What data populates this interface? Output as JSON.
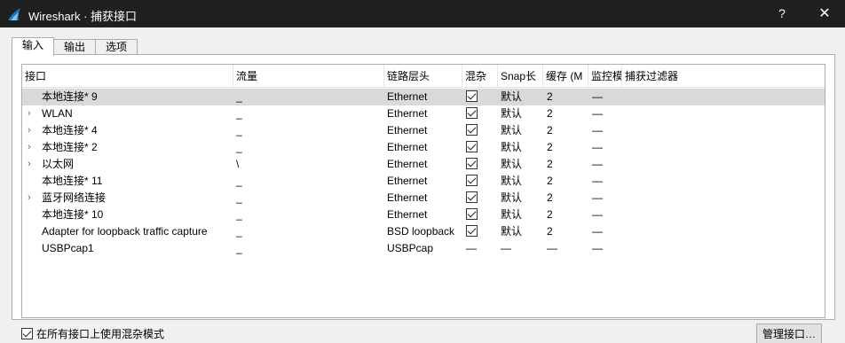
{
  "window": {
    "title": "Wireshark · 捕获接口",
    "help_glyph": "?",
    "close_glyph": "✕"
  },
  "tabs": [
    {
      "label": "输入",
      "active": true
    },
    {
      "label": "输出",
      "active": false
    },
    {
      "label": "选项",
      "active": false
    }
  ],
  "table": {
    "headers": [
      "接口",
      "流量",
      "链路层头",
      "混杂",
      "Snap长",
      "缓存 (M",
      "监控模",
      "捕获过滤器"
    ],
    "rows": [
      {
        "expandable": false,
        "interface": "本地连接* 9",
        "traffic": "_",
        "link": "Ethernet",
        "promisc": true,
        "snap": "默认",
        "buffer": "2",
        "monitor": "—",
        "filter": "",
        "selected": true
      },
      {
        "expandable": true,
        "interface": "WLAN",
        "traffic": "_",
        "link": "Ethernet",
        "promisc": true,
        "snap": "默认",
        "buffer": "2",
        "monitor": "—",
        "filter": "",
        "selected": false
      },
      {
        "expandable": true,
        "interface": "本地连接* 4",
        "traffic": "_",
        "link": "Ethernet",
        "promisc": true,
        "snap": "默认",
        "buffer": "2",
        "monitor": "—",
        "filter": "",
        "selected": false
      },
      {
        "expandable": true,
        "interface": "本地连接* 2",
        "traffic": "_",
        "link": "Ethernet",
        "promisc": true,
        "snap": "默认",
        "buffer": "2",
        "monitor": "—",
        "filter": "",
        "selected": false
      },
      {
        "expandable": true,
        "interface": "以太网",
        "traffic": "\\",
        "link": "Ethernet",
        "promisc": true,
        "snap": "默认",
        "buffer": "2",
        "monitor": "—",
        "filter": "",
        "selected": false
      },
      {
        "expandable": false,
        "interface": "本地连接* 11",
        "traffic": "_",
        "link": "Ethernet",
        "promisc": true,
        "snap": "默认",
        "buffer": "2",
        "monitor": "—",
        "filter": "",
        "selected": false
      },
      {
        "expandable": true,
        "interface": "蓝牙网络连接",
        "traffic": "_",
        "link": "Ethernet",
        "promisc": true,
        "snap": "默认",
        "buffer": "2",
        "monitor": "—",
        "filter": "",
        "selected": false
      },
      {
        "expandable": false,
        "interface": "本地连接* 10",
        "traffic": "_",
        "link": "Ethernet",
        "promisc": true,
        "snap": "默认",
        "buffer": "2",
        "monitor": "—",
        "filter": "",
        "selected": false
      },
      {
        "expandable": false,
        "interface": "Adapter for loopback traffic capture",
        "traffic": "_",
        "link": "BSD loopback",
        "promisc": true,
        "snap": "默认",
        "buffer": "2",
        "monitor": "—",
        "filter": "",
        "selected": false
      },
      {
        "expandable": false,
        "interface": "USBPcap1",
        "traffic": "_",
        "link": "USBPcap",
        "promisc": null,
        "snap": "—",
        "buffer": "—",
        "monitor": "—",
        "filter": "",
        "selected": false
      }
    ]
  },
  "footer": {
    "promisc_all_label": "在所有接口上使用混杂模式",
    "promisc_all_checked": true,
    "manage_button_label": "管理接口…"
  },
  "colors": {
    "titlebar": "#202020",
    "selected_row": "#d9d9d9",
    "wireshark_fin": "#1679c5"
  }
}
